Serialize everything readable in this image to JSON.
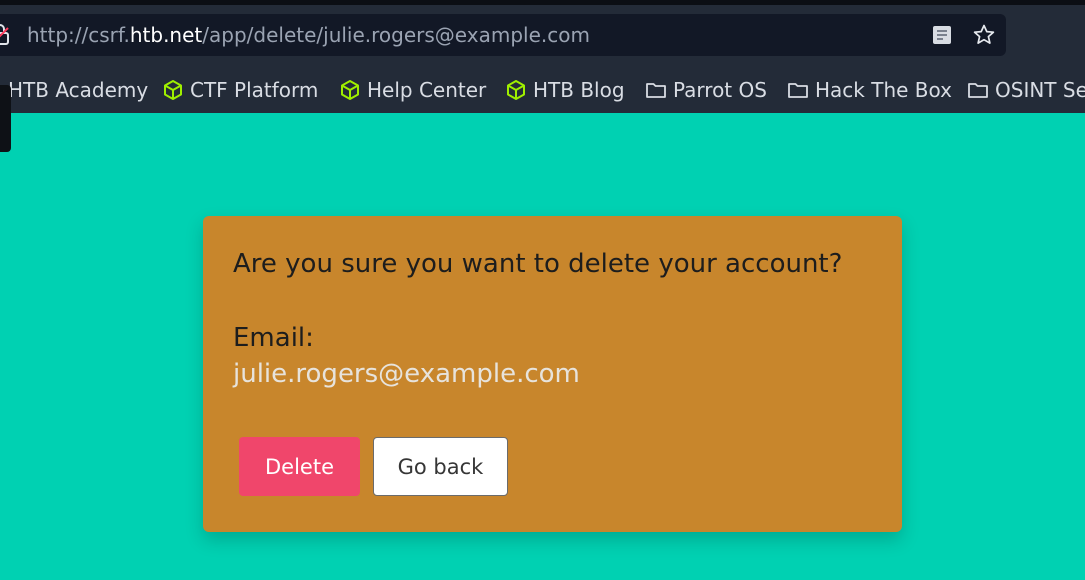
{
  "browser": {
    "url_prefix": "http://csrf.",
    "url_host": "htb.net",
    "url_path": "/app/delete/julie.rogers@example.com",
    "bookmarks": [
      {
        "label": "HTB Academy",
        "icon": "hackthebox-icon"
      },
      {
        "label": "CTF Platform",
        "icon": "hackthebox-icon"
      },
      {
        "label": "Help Center",
        "icon": "hackthebox-icon"
      },
      {
        "label": "HTB Blog",
        "icon": "hackthebox-icon"
      },
      {
        "label": "Parrot OS",
        "icon": "folder-icon"
      },
      {
        "label": "Hack The Box",
        "icon": "folder-icon"
      },
      {
        "label": "OSINT Se",
        "icon": "folder-icon"
      }
    ]
  },
  "dialog": {
    "question": "Are you sure you want to delete your account?",
    "email_label": "Email:",
    "email_value": "julie.rogers@example.com",
    "delete_label": "Delete",
    "back_label": "Go back"
  },
  "colors": {
    "page_background": "#00d1b2",
    "card_background": "#c8862c",
    "delete_button": "#f0466b",
    "bookmark_icon": "#9fef00"
  }
}
